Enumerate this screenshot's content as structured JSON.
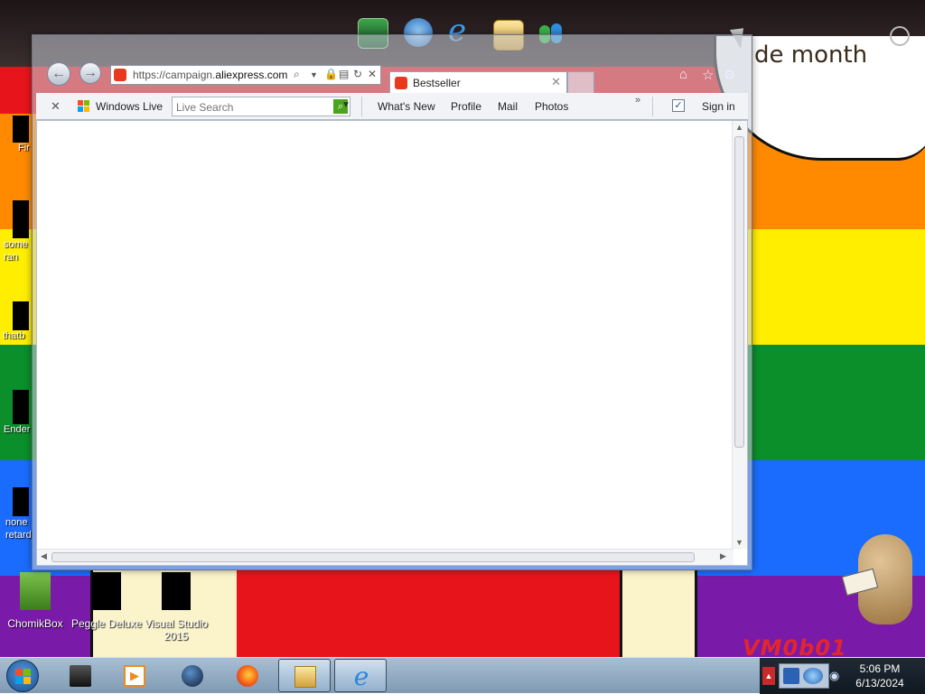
{
  "desktop": {
    "wallpaper_colors": [
      "#e7151b",
      "#ff8a00",
      "#ffee00",
      "#0b8f2a",
      "#1a6cff",
      "#7a1aa8"
    ],
    "cloud_text": "de month",
    "icons": [
      {
        "label": "ChomikBox"
      },
      {
        "label": "Peggle Deluxe"
      },
      {
        "label": "Visual Studio 2015"
      }
    ],
    "left_partial_icons": [
      {
        "label": "Fir"
      },
      {
        "label": "some ran"
      },
      {
        "label": "thatb"
      },
      {
        "label": "Ender"
      },
      {
        "label": "none retard"
      }
    ],
    "watermark": "VM0b01"
  },
  "browser": {
    "address": {
      "url_prefix": "https://campaign.",
      "url_domain": "aliexpress.com"
    },
    "tab": {
      "title": "Bestseller"
    },
    "toolbar": {
      "windows_live": "Windows Live",
      "search_placeholder": "Live Search",
      "links": [
        "What's New",
        "Profile",
        "Mail",
        "Photos"
      ],
      "more": "»",
      "sign_in": "Sign in"
    }
  },
  "taskbar": {
    "clock_time": "5:06 PM",
    "clock_date": "6/13/2024"
  }
}
